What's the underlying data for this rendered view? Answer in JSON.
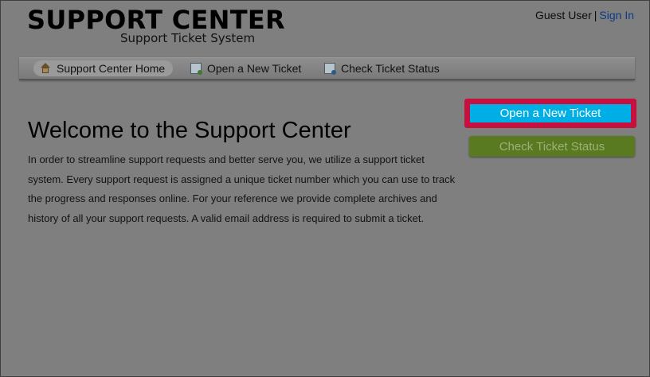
{
  "header": {
    "logo_title": "SUPPORT CENTER",
    "logo_subtitle": "Support Ticket System",
    "user_name": "Guest User",
    "separator": "|",
    "sign_in_label": "Sign In"
  },
  "nav": {
    "items": [
      {
        "label": "Support Center Home",
        "icon": "home-icon",
        "active": true
      },
      {
        "label": "Open a New Ticket",
        "icon": "new-ticket-icon",
        "active": false
      },
      {
        "label": "Check Ticket Status",
        "icon": "ticket-status-icon",
        "active": false
      }
    ]
  },
  "main": {
    "title": "Welcome to the Support Center",
    "intro": "In order to streamline support requests and better serve you, we utilize a support ticket system. Every support request is assigned a unique ticket number which you can use to track the progress and responses online. For your reference we provide complete archives and history of all your support requests. A valid email address is required to submit a ticket."
  },
  "sidebar": {
    "open_ticket_label": "Open a New Ticket",
    "check_status_label": "Check Ticket Status"
  },
  "colors": {
    "overlay_background": "#7f7f7f",
    "highlight_border": "#c8103e",
    "open_button": "#00aee6",
    "check_button": "#597a20",
    "link": "#0b3a88"
  }
}
